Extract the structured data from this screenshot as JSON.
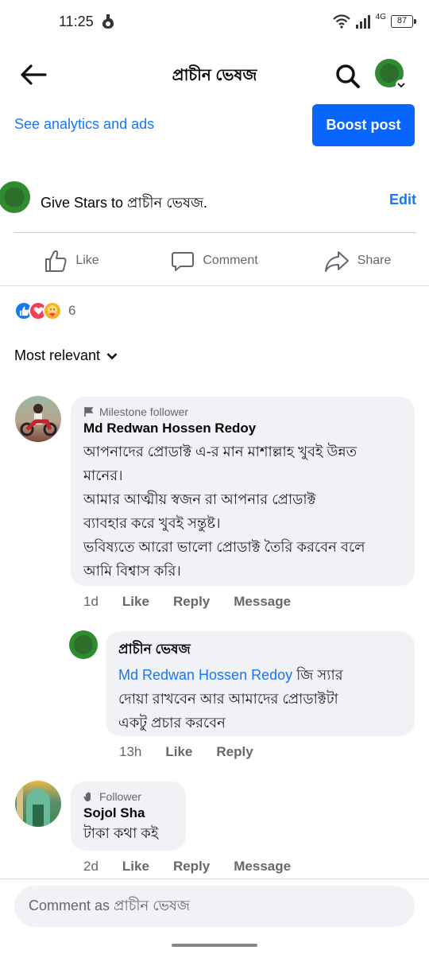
{
  "status": {
    "time": "11:25",
    "network": "4G",
    "battery": "87"
  },
  "header": {
    "title": "প্রাচীন ভেষজ"
  },
  "analytics": {
    "link_label": "See analytics and ads",
    "boost_label": "Boost post"
  },
  "stars": {
    "text": "Give Stars to প্রাচীন ভেষজ.",
    "edit_label": "Edit"
  },
  "actions": {
    "like": "Like",
    "comment": "Comment",
    "share": "Share"
  },
  "reactions": {
    "count": "6"
  },
  "sort": {
    "label": "Most relevant"
  },
  "comments": [
    {
      "badge": "Milestone follower",
      "name": "Md Redwan Hossen Redoy",
      "lines": [
        "আপনাদের প্রোডাক্ট এ-র মান মাশাল্লাহ খুবই উন্নত",
        "মানের।",
        "আমার আত্মীয় স্বজন রা আপনার প্রোডাক্ট",
        "ব্যাবহার করে খুবই সন্তুষ্ট।",
        "ভবিষ্যতে আরো ভালো প্রোডাক্ট তৈরি করবেন বলে",
        "আমি বিশ্বাস করি।"
      ],
      "time": "1d",
      "like": "Like",
      "reply": "Reply",
      "message": "Message"
    },
    {
      "name": "প্রাচীন ভেষজ",
      "mention": "Md Redwan Hossen Redoy",
      "line1_rest": " জি স্যার",
      "lines": [
        "দোয়া রাখবেন আর আমাদের প্রোডাক্টটা",
        "একটু প্রচার করবেন"
      ],
      "time": "13h",
      "like": "Like",
      "reply": "Reply"
    },
    {
      "badge": "Follower",
      "name": "Sojol Sha",
      "lines": [
        "টাকা কথা কই"
      ],
      "time": "2d",
      "like": "Like",
      "reply": "Reply",
      "message": "Message"
    }
  ],
  "composer": {
    "placeholder": "Comment as প্রাচীন ভেষজ"
  },
  "logo": {
    "text": "প্রাচীন ভেষজ"
  }
}
